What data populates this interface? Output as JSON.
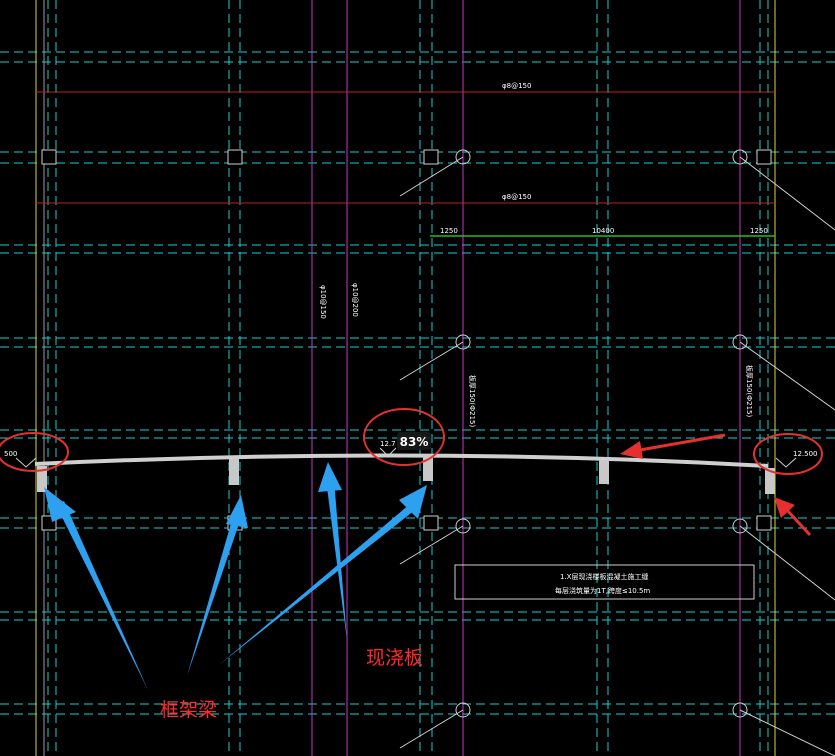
{
  "drawing": {
    "rebar_top": "φ8@150",
    "rebar_mid": "φ8@150",
    "dim_left": "1250",
    "dim_center": "10400",
    "dim_right": "1250",
    "vert_label_a": "φ10@150",
    "vert_label_b": "φ10@200",
    "vert_label_c": "板厚150(Ф215)",
    "vert_label_d": "板厚150(Ф215)",
    "elev_left": "500",
    "elev_center": "12.7",
    "elev_right": "12.500",
    "note_line1": "1.X层现浇楼板混凝土施工缝",
    "note_line2": "每层浇筑量为1T,跨度≤10.5m"
  },
  "overlay": {
    "percent_badge": "83%",
    "label_slab": "现浇板",
    "label_beam": "框架梁"
  },
  "colors": {
    "background": "#000000",
    "grid_dash": "#19d0d0",
    "column_outline": "#cfcfcf",
    "axis_yellow": "#d8d830",
    "axis_magenta": "#c03cc0",
    "red_line": "#c02020",
    "green_line": "#20c020",
    "annotation_red": "#e53030",
    "arrow_blue": "#2ea0f0"
  }
}
